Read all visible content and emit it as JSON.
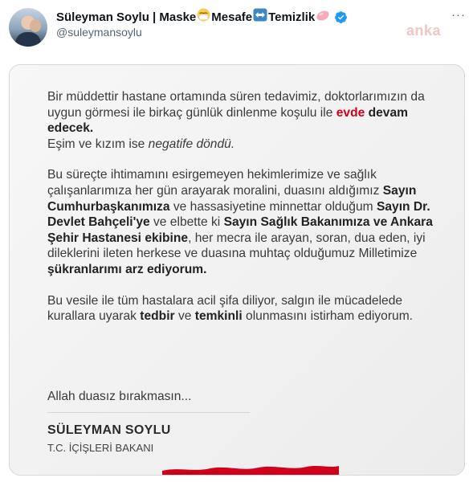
{
  "tweet": {
    "name_part1": "Süleyman Soylu | Maske",
    "name_part2": "Mesafe",
    "name_part3": "Temizlik",
    "handle": "@suleymansoylu",
    "more": "···",
    "watermark": "anka"
  },
  "letter": {
    "p1_a": "Bir müddettir hastane ortamında süren tedavimiz, doktorlarımızın da uygun görmesi ile birkaç günlük dinlenme koşulu ile ",
    "p1_evde": "evde",
    "p1_space": " ",
    "p1_devam": "devam edecek.",
    "p1_b": "Eşim ve kızım ise ",
    "p1_neg": "negatife döndü.",
    "p2_a": "Bu süreçte ihtimamını esirgemeyen hekimlerimize ve sağlık çalışanlarımıza her gün arayarak moralini, duasını aldığımız ",
    "p2_cb": "Sayın Cumhurbaşkanımıza",
    "p2_b": " ve hassasiyetine minnettar olduğum ",
    "p2_db": "Sayın Dr. Devlet Bahçeli'ye",
    "p2_c": " ve elbette ki ",
    "p2_sb": "Sayın Sağlık Bakanımıza ve Ankara Şehir Hastanesi ekibine",
    "p2_d": ", her mecra ile arayan, soran, dua eden, iyi dileklerini ileten herkese ve duasına muhtaç olduğumuz Milletimize ",
    "p2_sk": "şükranlarımı arz ediyorum.",
    "p3_a": "Bu vesile ile tüm hastalara acil şifa diliyor, salgın ile mücadelede kurallara uyarak ",
    "p3_t1": "tedbir",
    "p3_b": " ve ",
    "p3_t2": "temkinli",
    "p3_c": " olunmasını istirham ediyorum.",
    "closing": "Allah duasız bırakmasın...",
    "signature_name": "SÜLEYMAN SOYLU",
    "signature_title": "T.C. İÇİŞLERİ BAKANI"
  },
  "icons": {
    "mask": "mask-emoji",
    "arrows": "left-right-arrow-emoji",
    "soap": "soap-emoji",
    "verified": "verified-badge-icon"
  },
  "colors": {
    "accent_red": "#d0021b",
    "verified_blue": "#1d9bf0"
  }
}
